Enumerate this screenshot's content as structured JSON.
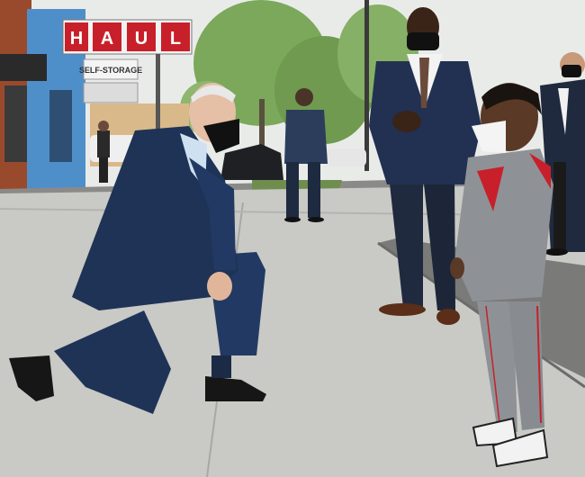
{
  "photo": {
    "signs": {
      "uhaul_letters": [
        "H",
        "A",
        "U",
        "L"
      ],
      "self_storage": "SELF-STORAGE"
    },
    "colors": {
      "sky": "#e9ebe9",
      "sidewalk": "#c9c9c5",
      "road": "#8a8a88",
      "building_blue": "#4f8fc9",
      "building_brick": "#9a4a2c",
      "sign_red": "#c8202a",
      "suit_navy": "#1e3356",
      "suit_dark": "#1f2a3e",
      "hoodie_gray": "#8e9296",
      "tree_green": "#7ba85a"
    }
  }
}
